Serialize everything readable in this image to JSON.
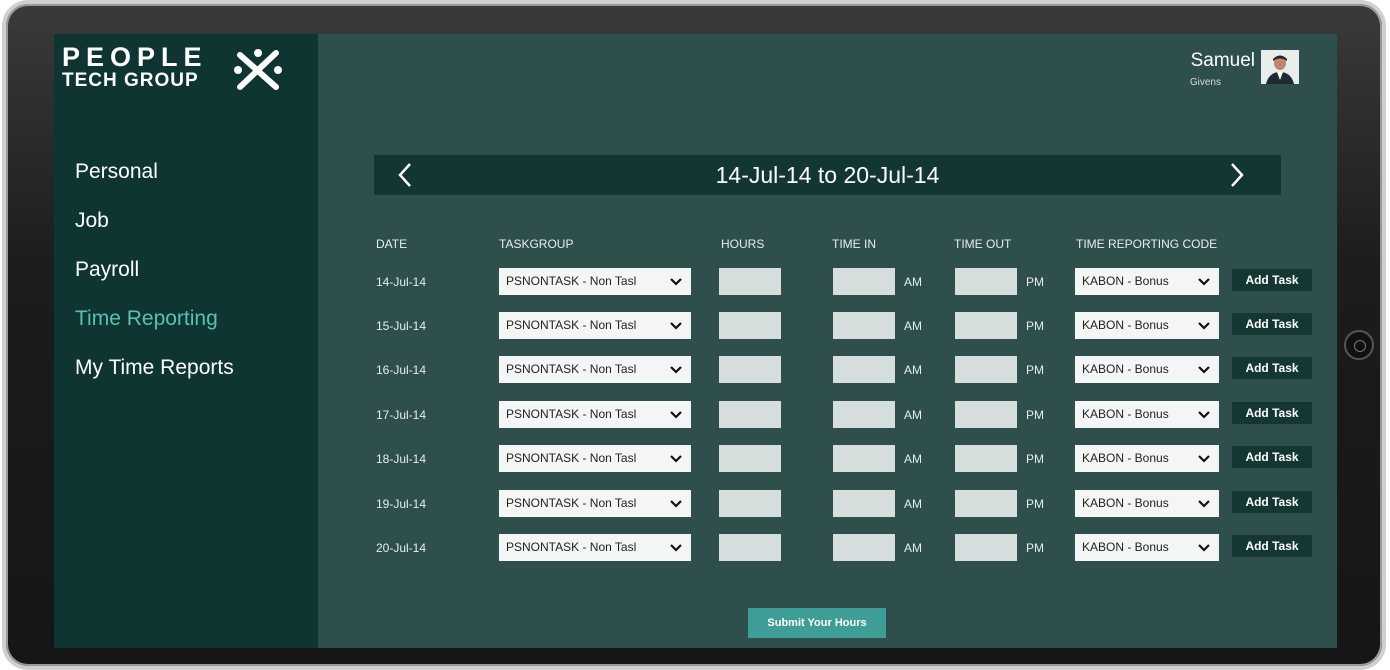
{
  "logo": {
    "line1": "PEOPLE",
    "line2": "TECH GROUP"
  },
  "user": {
    "first_name": "Samuel",
    "last_name": "Givens"
  },
  "nav": {
    "items": [
      {
        "label": "Personal",
        "active": false
      },
      {
        "label": "Job",
        "active": false
      },
      {
        "label": "Payroll",
        "active": false
      },
      {
        "label": "Time Reporting",
        "active": true
      },
      {
        "label": "My Time Reports",
        "active": false
      }
    ]
  },
  "week": {
    "label": "14-Jul-14 to 20-Jul-14"
  },
  "table": {
    "headers": {
      "date": "DATE",
      "taskgroup": "TASKGROUP",
      "hours": "HOURS",
      "time_in": "TIME IN",
      "time_out": "TIME OUT",
      "code": "TIME REPORTING CODE"
    },
    "rows": [
      {
        "date": "14-Jul-14",
        "taskgroup": "PSNONTASK - Non Tasl",
        "am": "AM",
        "pm": "PM",
        "code": "KABON - Bonus",
        "action": "Add Task"
      },
      {
        "date": "15-Jul-14",
        "taskgroup": "PSNONTASK - Non Tasl",
        "am": "AM",
        "pm": "PM",
        "code": "KABON - Bonus",
        "action": "Add Task"
      },
      {
        "date": "16-Jul-14",
        "taskgroup": "PSNONTASK - Non Tasl",
        "am": "AM",
        "pm": "PM",
        "code": "KABON - Bonus",
        "action": "Add Task"
      },
      {
        "date": "17-Jul-14",
        "taskgroup": "PSNONTASK - Non Tasl",
        "am": "AM",
        "pm": "PM",
        "code": "KABON - Bonus",
        "action": "Add Task"
      },
      {
        "date": "18-Jul-14",
        "taskgroup": "PSNONTASK - Non Tasl",
        "am": "AM",
        "pm": "PM",
        "code": "KABON - Bonus",
        "action": "Add Task"
      },
      {
        "date": "19-Jul-14",
        "taskgroup": "PSNONTASK - Non Tasl",
        "am": "AM",
        "pm": "PM",
        "code": "KABON - Bonus",
        "action": "Add Task"
      },
      {
        "date": "20-Jul-14",
        "taskgroup": "PSNONTASK - Non Tasl",
        "am": "AM",
        "pm": "PM",
        "code": "KABON - Bonus",
        "action": "Add Task"
      }
    ]
  },
  "submit_label": "Submit Your Hours",
  "colors": {
    "sidebar": "#0f3533",
    "content": "#2f4f4d",
    "accent": "#59c0b3",
    "submit": "#3e9d96"
  },
  "icons": {
    "prev": "chevron-left-icon",
    "next": "chevron-right-icon",
    "dropdown": "chevron-down-icon"
  }
}
